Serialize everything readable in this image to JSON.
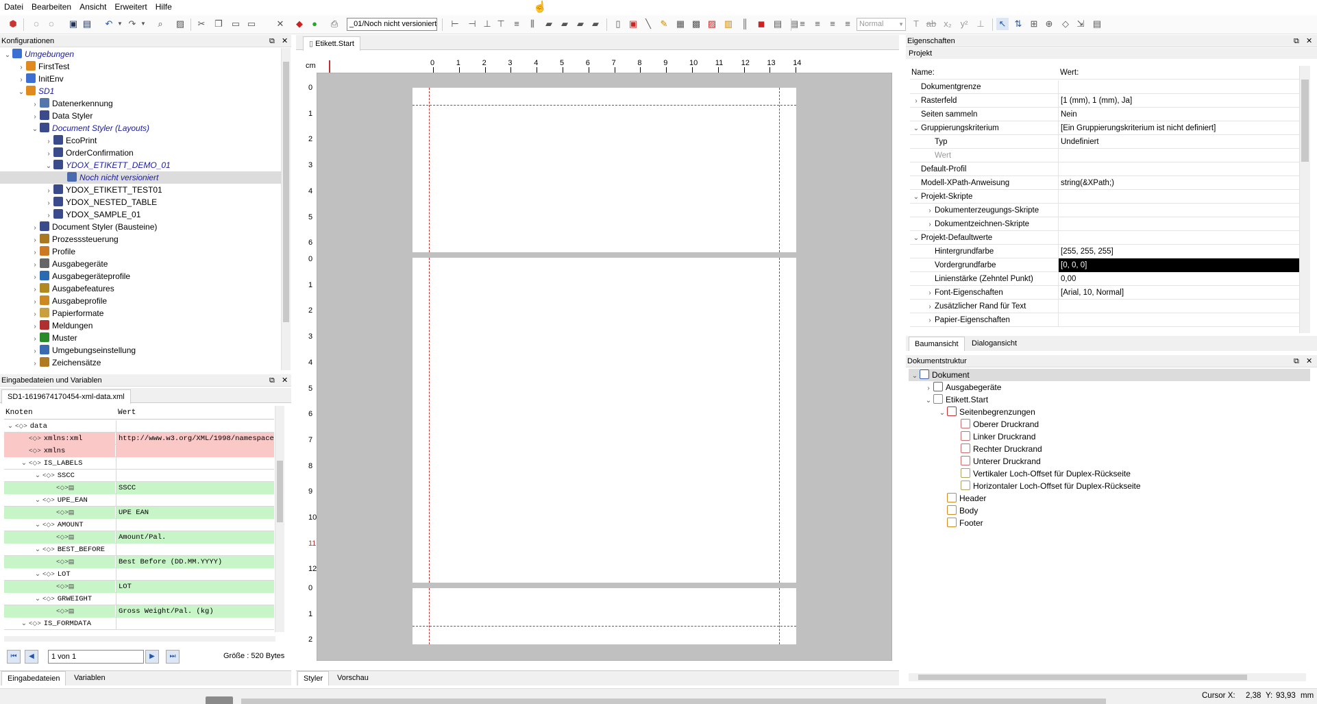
{
  "menu": [
    "Datei",
    "Bearbeiten",
    "Ansicht",
    "Erweitert",
    "Hilfe"
  ],
  "toolbar": {
    "version_combo": "_01/Noch nicht versioniert",
    "style_combo": "Normal"
  },
  "config_panel": {
    "title": "Konfigurationen",
    "tree": [
      {
        "label": "Umgebungen",
        "style": "italic-blue",
        "expanded": true,
        "icon": "globe-icon"
      },
      {
        "label": "FirstTest",
        "icon": "env-icon"
      },
      {
        "label": "InitEnv",
        "icon": "globe-icon"
      },
      {
        "label": "SD1",
        "style": "italic-blue",
        "expanded": true,
        "icon": "env-icon"
      },
      {
        "label": "Datenerkennung",
        "icon": "data-recognition-icon"
      },
      {
        "label": "Data Styler",
        "icon": "grid-icon"
      },
      {
        "label": "Document Styler (Layouts)",
        "style": "italic-blue",
        "expanded": true,
        "icon": "grid-icon"
      },
      {
        "label": "EcoPrint",
        "icon": "grid-icon"
      },
      {
        "label": "OrderConfirmation",
        "icon": "grid-icon"
      },
      {
        "label": "YDOX_ETIKETT_DEMO_01",
        "style": "italic-blue",
        "expanded": true,
        "icon": "grid-icon"
      },
      {
        "label": "Noch nicht versioniert",
        "style": "italic-blue",
        "selected": true,
        "icon": "version-icon"
      },
      {
        "label": "YDOX_ETIKETT_TEST01",
        "icon": "grid-icon"
      },
      {
        "label": "YDOX_NESTED_TABLE",
        "icon": "grid-icon"
      },
      {
        "label": "YDOX_SAMPLE_01",
        "icon": "grid-icon"
      },
      {
        "label": "Document Styler (Bausteine)",
        "icon": "grid-icon"
      },
      {
        "label": "Prozesssteuerung",
        "icon": "process-icon"
      },
      {
        "label": "Profile",
        "icon": "profile-icon"
      },
      {
        "label": "Ausgabegeräte",
        "icon": "device-icon"
      },
      {
        "label": "Ausgabegeräteprofile",
        "icon": "device-profile-icon"
      },
      {
        "label": "Ausgabefeatures",
        "icon": "feature-icon"
      },
      {
        "label": "Ausgabeprofile",
        "icon": "output-profile-icon"
      },
      {
        "label": "Papierformate",
        "icon": "paper-icon"
      },
      {
        "label": "Meldungen",
        "icon": "message-icon"
      },
      {
        "label": "Muster",
        "icon": "pattern-icon"
      },
      {
        "label": "Umgebungseinstellung",
        "icon": "settings-icon"
      },
      {
        "label": "Zeichensätze",
        "icon": "charset-icon"
      }
    ]
  },
  "input_panel": {
    "title": "Eingabedateien und Variablen",
    "file_tab": "SD1-1619674170454-xml-data.xml",
    "col_node": "Knoten",
    "col_value": "Wert",
    "rows": [
      {
        "key": "data",
        "val": "",
        "color": "",
        "level": 0,
        "exp": true
      },
      {
        "key": "xmlns:xml",
        "val": "http://www.w3.org/XML/1998/namespace",
        "color": "pink",
        "level": 1,
        "exp": false
      },
      {
        "key": "xmlns",
        "val": "",
        "color": "pink",
        "level": 1,
        "exp": false
      },
      {
        "key": "IS_LABELS",
        "val": "",
        "color": "",
        "level": 1,
        "exp": true
      },
      {
        "key": "SSCC",
        "val": "",
        "color": "",
        "level": 2,
        "exp": true
      },
      {
        "key": "",
        "val": "SSCC",
        "color": "green",
        "level": 3,
        "exp": false
      },
      {
        "key": "UPE_EAN",
        "val": "",
        "color": "",
        "level": 2,
        "exp": true
      },
      {
        "key": "",
        "val": "UPE EAN",
        "color": "green",
        "level": 3,
        "exp": false
      },
      {
        "key": "AMOUNT",
        "val": "",
        "color": "",
        "level": 2,
        "exp": true
      },
      {
        "key": "",
        "val": "Amount/Pal.",
        "color": "green",
        "level": 3,
        "exp": false
      },
      {
        "key": "BEST_BEFORE",
        "val": "",
        "color": "",
        "level": 2,
        "exp": true
      },
      {
        "key": "",
        "val": "Best Before (DD.MM.YYYY)",
        "color": "green",
        "level": 3,
        "exp": false
      },
      {
        "key": "LOT",
        "val": "",
        "color": "",
        "level": 2,
        "exp": true
      },
      {
        "key": "",
        "val": "LOT",
        "color": "green",
        "level": 3,
        "exp": false
      },
      {
        "key": "GRWEIGHT",
        "val": "",
        "color": "",
        "level": 2,
        "exp": true
      },
      {
        "key": "",
        "val": "Gross Weight/Pal. (kg)",
        "color": "green",
        "level": 3,
        "exp": false
      },
      {
        "key": "IS_FORMDATA",
        "val": "",
        "color": "",
        "level": 1,
        "exp": true
      }
    ],
    "pager": "1 von 1",
    "size": "Größe : 520 Bytes",
    "bottom_tabs": [
      "Eingabedateien",
      "Variablen"
    ]
  },
  "editor": {
    "tab": "Etikett.Start",
    "unit": "cm",
    "h_ruler": [
      "0",
      "1",
      "2",
      "3",
      "4",
      "5",
      "6",
      "7",
      "8",
      "9",
      "10",
      "11",
      "12",
      "13",
      "14"
    ],
    "v_ruler_1": [
      "0",
      "1",
      "2",
      "3",
      "4",
      "5",
      "6"
    ],
    "v_ruler_2": [
      "0",
      "1",
      "2",
      "3",
      "4",
      "5",
      "6",
      "7",
      "8",
      "9",
      "10",
      "11",
      "12"
    ],
    "v_ruler_3": [
      "0",
      "1",
      "2"
    ],
    "bottom_tabs": [
      "Styler",
      "Vorschau"
    ]
  },
  "properties": {
    "title": "Eigenschaften",
    "subtitle": "Projekt",
    "col_name": "Name:",
    "col_value": "Wert:",
    "rows": [
      {
        "name": "Dokumentgrenze",
        "val": "",
        "indent": 0,
        "exp": ""
      },
      {
        "name": "Rasterfeld",
        "val": "[1 (mm), 1 (mm), Ja]",
        "indent": 0,
        "exp": "closed"
      },
      {
        "name": "Seiten sammeln",
        "val": "Nein",
        "indent": 0,
        "exp": ""
      },
      {
        "name": "Gruppierungskriterium",
        "val": "[Ein Gruppierungskriterium ist nicht definiert]",
        "indent": 0,
        "exp": "open"
      },
      {
        "name": "Typ",
        "val": "Undefiniert",
        "indent": 1,
        "exp": ""
      },
      {
        "name": "Wert",
        "val": "",
        "indent": 1,
        "exp": "",
        "disabled": true
      },
      {
        "name": "Default-Profil",
        "val": "",
        "indent": 0,
        "exp": ""
      },
      {
        "name": "Modell-XPath-Anweisung",
        "val": "string(&XPath;)",
        "indent": 0,
        "exp": ""
      },
      {
        "name": "Projekt-Skripte",
        "val": "",
        "indent": 0,
        "exp": "open"
      },
      {
        "name": "Dokumenterzeugungs-Skripte",
        "val": "",
        "indent": 1,
        "exp": "closed"
      },
      {
        "name": "Dokumentzeichnen-Skripte",
        "val": "",
        "indent": 1,
        "exp": "closed"
      },
      {
        "name": "Projekt-Defaultwerte",
        "val": "",
        "indent": 0,
        "exp": "open"
      },
      {
        "name": "Hintergrundfarbe",
        "val": "[255, 255, 255]",
        "indent": 1,
        "exp": ""
      },
      {
        "name": "Vordergrundfarbe",
        "val": "[0, 0, 0]",
        "indent": 1,
        "exp": "",
        "black": true
      },
      {
        "name": "Linienstärke (Zehntel Punkt)",
        "val": "0,00",
        "indent": 1,
        "exp": ""
      },
      {
        "name": "Font-Eigenschaften",
        "val": "[Arial, 10, Normal]",
        "indent": 1,
        "exp": "closed"
      },
      {
        "name": "Zusätzlicher Rand für Text",
        "val": "",
        "indent": 1,
        "exp": "closed"
      },
      {
        "name": "Papier-Eigenschaften",
        "val": "",
        "indent": 1,
        "exp": "closed"
      }
    ],
    "tabs": [
      "Baumansicht",
      "Dialogansicht"
    ]
  },
  "doc_structure": {
    "title": "Dokumentstruktur",
    "tree": [
      {
        "label": "Dokument",
        "level": 0,
        "exp": "open",
        "icon": "document-icon",
        "selected": true
      },
      {
        "label": "Ausgabegeräte",
        "level": 1,
        "exp": "closed",
        "icon": "device-icon"
      },
      {
        "label": "Etikett.Start",
        "level": 1,
        "exp": "open",
        "icon": "page-icon"
      },
      {
        "label": "Seitenbegrenzungen",
        "level": 2,
        "exp": "open",
        "icon": "bounds-icon"
      },
      {
        "label": "Oberer Druckrand",
        "level": 3,
        "exp": "",
        "icon": "margin-icon"
      },
      {
        "label": "Linker Druckrand",
        "level": 3,
        "exp": "",
        "icon": "margin-icon"
      },
      {
        "label": "Rechter Druckrand",
        "level": 3,
        "exp": "",
        "icon": "margin-icon"
      },
      {
        "label": "Unterer Druckrand",
        "level": 3,
        "exp": "",
        "icon": "margin-icon"
      },
      {
        "label": "Vertikaler Loch-Offset für Duplex-Rückseite",
        "level": 3,
        "exp": "",
        "icon": "offset-icon"
      },
      {
        "label": "Horizontaler Loch-Offset für Duplex-Rückseite",
        "level": 3,
        "exp": "",
        "icon": "offset-icon"
      },
      {
        "label": "Header",
        "level": 2,
        "exp": "",
        "icon": "band-icon"
      },
      {
        "label": "Body",
        "level": 2,
        "exp": "",
        "icon": "band-icon"
      },
      {
        "label": "Footer",
        "level": 2,
        "exp": "",
        "icon": "band-icon"
      }
    ]
  },
  "status": {
    "cursor_x_label": "Cursor X:",
    "cursor_x": "2,38",
    "cursor_y_label": "Y:",
    "cursor_y": "93,93",
    "unit": "mm"
  },
  "colors": {
    "accent_blue": "#1a1aa8",
    "margin_red": "#c03030",
    "pink_row": "#fbc8c8",
    "green_row": "#c8f5c8",
    "canvas_gray": "#c0c0c0"
  }
}
